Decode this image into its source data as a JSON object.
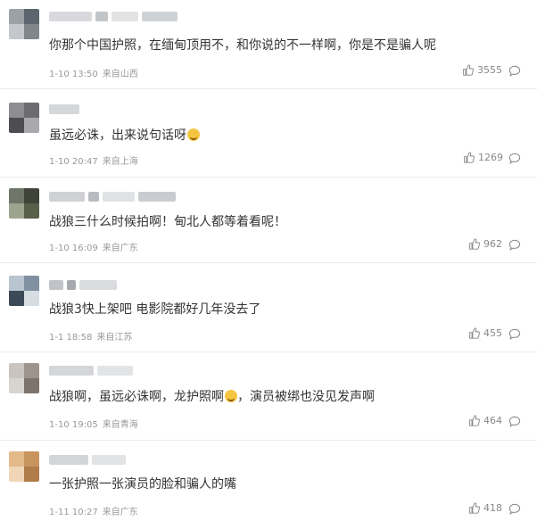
{
  "comments": [
    {
      "content": "你那个中国护照，在缅甸顶用不，和你说的不一样啊，你是不是骗人呢",
      "time": "1-10 13:50",
      "location": "来自山西",
      "likes": "3555",
      "emoji": false
    },
    {
      "content": "虽远必诛，出来说句话呀",
      "time": "1-10 20:47",
      "location": "来自上海",
      "likes": "1269",
      "emoji": true
    },
    {
      "content": "战狼三什么时候拍啊！甸北人都等着看呢！",
      "time": "1-10 16:09",
      "location": "来自广东",
      "likes": "962",
      "emoji": false
    },
    {
      "content": "战狼3快上架吧 电影院都好几年没去了",
      "time": "1-1 18:58",
      "location": "来自江苏",
      "likes": "455",
      "emoji": false
    },
    {
      "content_a": "战狼啊，虽远必诛啊，龙护照啊",
      "content_b": "，演员被绑也没见发声啊",
      "time": "1-10 19:05",
      "location": "来自青海",
      "likes": "464",
      "emoji": true
    },
    {
      "content": "一张护照一张演员的脸和骗人的嘴",
      "time": "1-11 10:27",
      "location": "来自广东",
      "likes": "418",
      "emoji": false
    }
  ],
  "icons": {
    "like": "thumbs-up-icon",
    "reply": "comment-bubble-icon",
    "emoji": "laughing-emoji-icon"
  },
  "colors": {
    "text": "#333333",
    "meta": "#999999",
    "divider": "#ececec"
  }
}
